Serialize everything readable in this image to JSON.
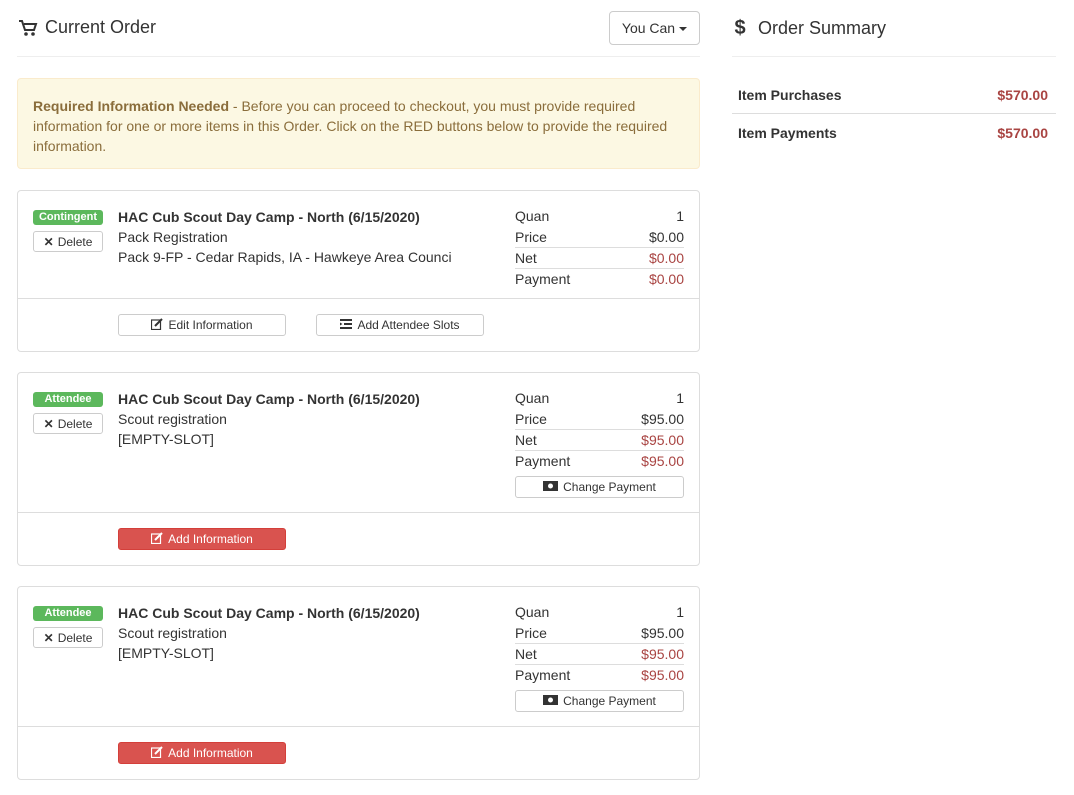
{
  "current_order": {
    "title": "Current Order",
    "you_can_label": "You Can"
  },
  "alert": {
    "strong": "Required Information Needed",
    "text": " - Before you can proceed to checkout, you must provide required information for one or more items in this Order. Click on the RED buttons below to provide the required information."
  },
  "items": [
    {
      "badge": "Contingent",
      "delete_label": "Delete",
      "event": "HAC Cub Scout Day Camp - North (6/15/2020)",
      "line2": "Pack Registration",
      "line3": "Pack 9-FP - Cedar Rapids, IA - Hawkeye Area Counci",
      "quan_label": "Quan",
      "quan": "1",
      "price_label": "Price",
      "price": "$0.00",
      "net_label": "Net",
      "net": "$0.00",
      "payment_label": "Payment",
      "payment": "$0.00",
      "edit_info_label": "Edit Information",
      "add_slots_label": "Add Attendee Slots"
    },
    {
      "badge": "Attendee",
      "delete_label": "Delete",
      "event": "HAC Cub Scout Day Camp - North (6/15/2020)",
      "line2": "Scout registration",
      "line3": "[EMPTY-SLOT]",
      "quan_label": "Quan",
      "quan": "1",
      "price_label": "Price",
      "price": "$95.00",
      "net_label": "Net",
      "net": "$95.00",
      "payment_label": "Payment",
      "payment": "$95.00",
      "change_payment_label": "Change Payment",
      "add_info_label": "Add Information"
    },
    {
      "badge": "Attendee",
      "delete_label": "Delete",
      "event": "HAC Cub Scout Day Camp - North (6/15/2020)",
      "line2": "Scout registration",
      "line3": "[EMPTY-SLOT]",
      "quan_label": "Quan",
      "quan": "1",
      "price_label": "Price",
      "price": "$95.00",
      "net_label": "Net",
      "net": "$95.00",
      "payment_label": "Payment",
      "payment": "$95.00",
      "change_payment_label": "Change Payment",
      "add_info_label": "Add Information"
    }
  ],
  "summary": {
    "title": "Order Summary",
    "rows": [
      {
        "label": "Item Purchases",
        "amount": "$570.00"
      },
      {
        "label": "Item Payments",
        "amount": "$570.00"
      }
    ]
  },
  "colors": {
    "alert_bg": "#fcf8e3",
    "alert_text": "#8a6d3b",
    "badge_green": "#5cb85c",
    "danger_red": "#d9534f",
    "amount_red": "#a94442"
  },
  "icons": {
    "cart": "cart-icon",
    "dollar": "dollar-icon",
    "delete": "times-icon",
    "edit": "edit-icon",
    "slots": "list-icon",
    "money": "money-icon"
  }
}
